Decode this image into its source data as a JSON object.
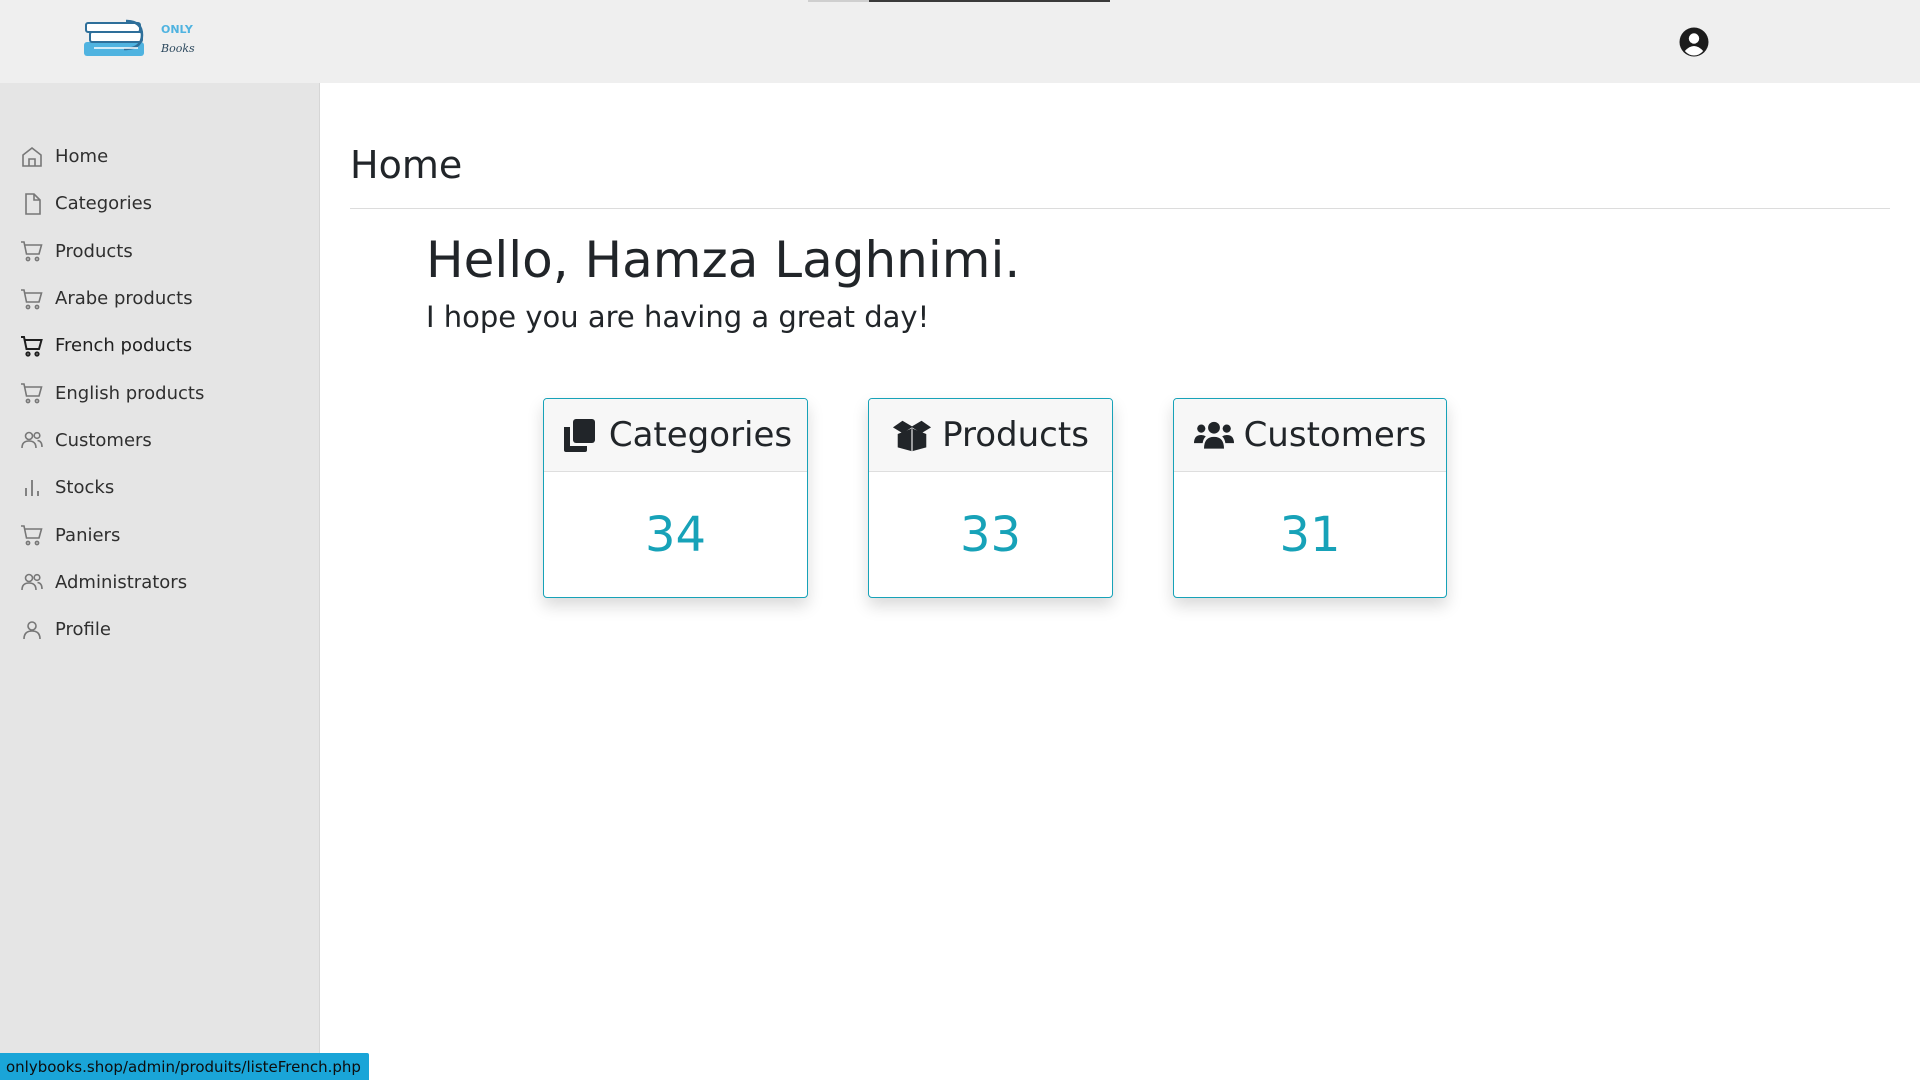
{
  "header": {
    "logo_text_top": "ONLY",
    "logo_text_bottom": "Books"
  },
  "sidebar": {
    "items": [
      {
        "label": "Home",
        "icon": "house-icon",
        "active": false
      },
      {
        "label": "Categories",
        "icon": "file-icon",
        "active": false
      },
      {
        "label": "Products",
        "icon": "cart-icon",
        "active": false
      },
      {
        "label": "Arabe products",
        "icon": "cart-icon",
        "active": false
      },
      {
        "label": "French poducts",
        "icon": "cart-icon",
        "active": true
      },
      {
        "label": "English products",
        "icon": "cart-icon",
        "active": false
      },
      {
        "label": "Customers",
        "icon": "users-icon",
        "active": false
      },
      {
        "label": "Stocks",
        "icon": "bar-chart-icon",
        "active": false
      },
      {
        "label": "Paniers",
        "icon": "cart-icon",
        "active": false
      },
      {
        "label": "Administrators",
        "icon": "users-icon",
        "active": false
      },
      {
        "label": "Profile",
        "icon": "user-icon",
        "active": false
      }
    ]
  },
  "main": {
    "title": "Home",
    "greeting": "Hello, Hamza Laghnimi.",
    "subgreeting": "I hope you are having a great day!",
    "cards": [
      {
        "title": "Categories",
        "icon": "copy-icon",
        "count": "34"
      },
      {
        "title": "Products",
        "icon": "box-open-icon",
        "count": "33"
      },
      {
        "title": "Customers",
        "icon": "users-solid-icon",
        "count": "31"
      }
    ]
  },
  "status_url": "onlybooks.shop/admin/produits/listeFrench.php",
  "colors": {
    "accent": "#17a2b8",
    "sidebar_bg": "#e5e5e5",
    "topbar_bg": "#efefef",
    "status_bg": "#1aa5d8"
  }
}
